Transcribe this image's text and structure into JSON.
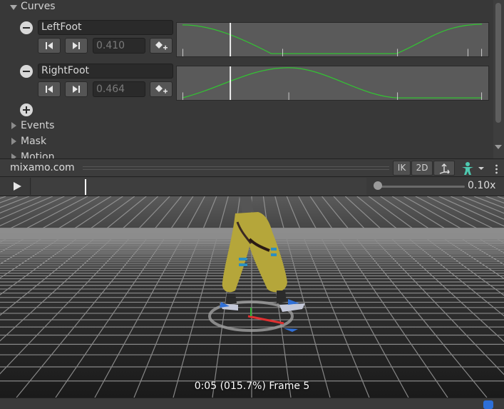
{
  "curves": {
    "section_label": "Curves",
    "items": [
      {
        "name": "LeftFoot",
        "value": "0.410"
      },
      {
        "name": "RightFoot",
        "value": "0.464"
      }
    ]
  },
  "sections": [
    {
      "label": "Events"
    },
    {
      "label": "Mask"
    },
    {
      "label": "Motion"
    }
  ],
  "preview": {
    "title": "mixamo.com",
    "buttons": {
      "ik": "IK",
      "two_d": "2D"
    },
    "speed": "0.10x",
    "status": "0:05 (015.7%) Frame 5"
  },
  "colors": {
    "curve": "#33c233",
    "accent": "#4ec9b0"
  }
}
